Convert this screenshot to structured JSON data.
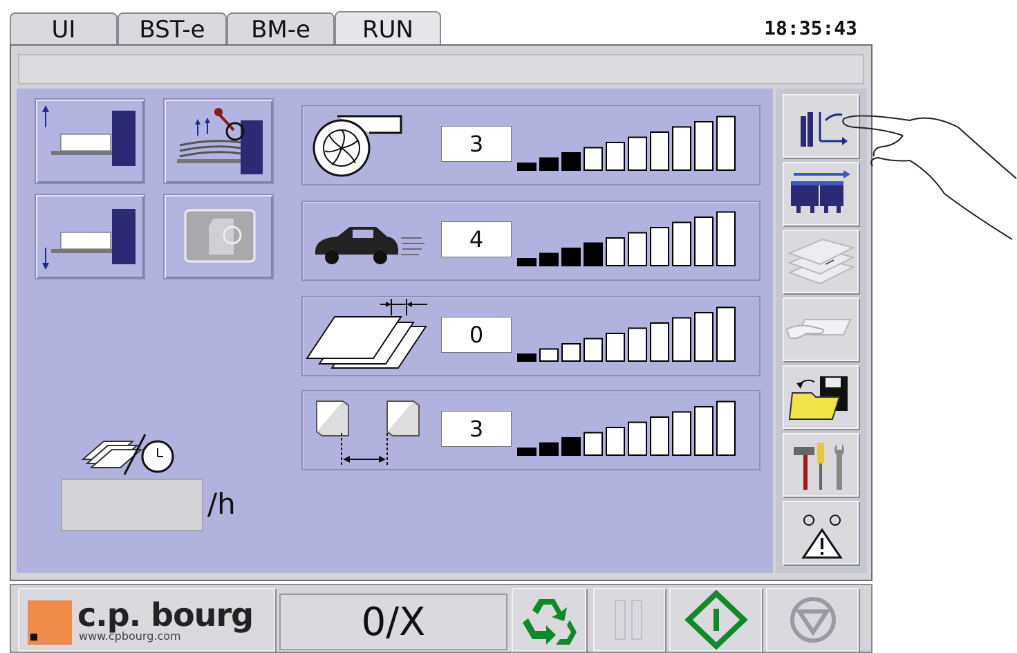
{
  "tabs": [
    {
      "label": "UI"
    },
    {
      "label": "BST-e"
    },
    {
      "label": "BM-e"
    },
    {
      "label": "RUN"
    }
  ],
  "active_tab": "RUN",
  "clock": "18:35:43",
  "settings": [
    {
      "icon": "air-blower-icon",
      "value": "3",
      "level": 3
    },
    {
      "icon": "speed-car-icon",
      "value": "4",
      "level": 4
    },
    {
      "icon": "sheet-separation-icon",
      "value": "0",
      "level": 1
    },
    {
      "icon": "sheet-gap-icon",
      "value": "3",
      "level": 3
    }
  ],
  "level_segments": 10,
  "rate_unit": "/h",
  "rate_value": "",
  "counter": "0/X",
  "brand": {
    "name": "c.p. bourg",
    "url": "www.cpbourg.com"
  },
  "colors": {
    "panel": "#b1b2de",
    "accent_navy": "#2b2a72",
    "logo_orange": "#f08a4b",
    "run_green": "#0f8a2a"
  }
}
